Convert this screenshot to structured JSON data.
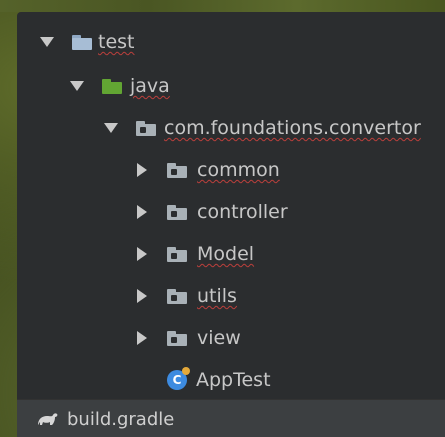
{
  "tree": {
    "items": [
      {
        "label": "test",
        "icon": "test-folder-icon",
        "expanded": true
      },
      {
        "label": "java",
        "icon": "source-folder-icon",
        "expanded": true
      },
      {
        "label": "com.foundations.convertor",
        "icon": "package-icon",
        "expanded": true
      },
      {
        "label": "common",
        "icon": "package-icon",
        "expanded": false
      },
      {
        "label": "controller",
        "icon": "package-icon",
        "expanded": false
      },
      {
        "label": "Model",
        "icon": "package-icon",
        "expanded": false
      },
      {
        "label": "utils",
        "icon": "package-icon",
        "expanded": false
      },
      {
        "label": "view",
        "icon": "package-icon",
        "expanded": false
      },
      {
        "label": "AppTest",
        "icon": "java-class-icon"
      }
    ],
    "footer": {
      "label": "build.gradle",
      "icon": "gradle-icon"
    }
  },
  "colors": {
    "panel_bg": "#2b2d2f",
    "text": "#c7c7c7",
    "spellcheck_underline": "#bc3f3c",
    "source_folder": "#62a533",
    "class_icon": "#3d8be0"
  }
}
